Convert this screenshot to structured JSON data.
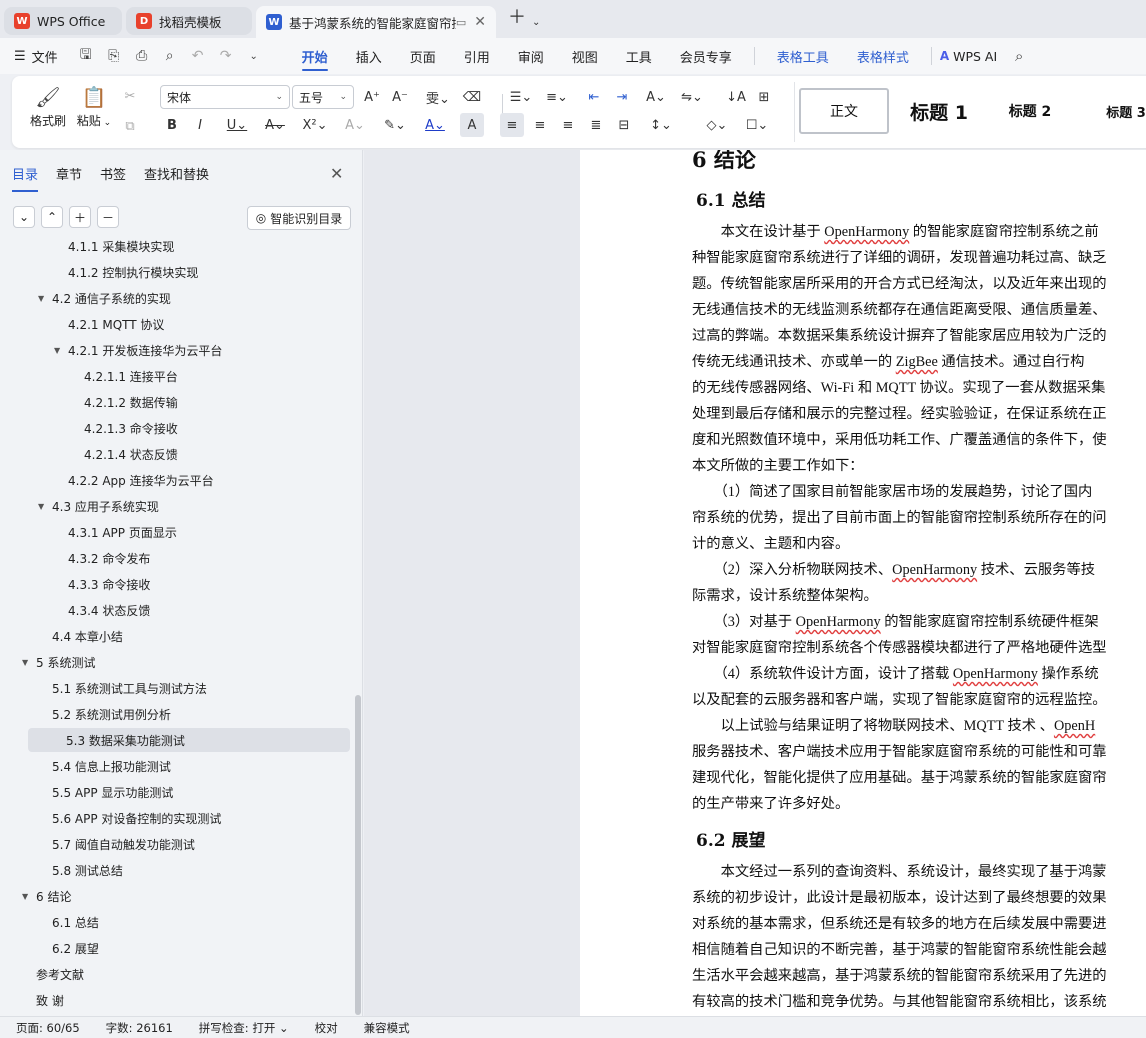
{
  "tabs": [
    {
      "label": "WPS Office",
      "logo": "W",
      "color": "#e8412c"
    },
    {
      "label": "找稻壳模板",
      "logo": "D",
      "color": "#e8412c"
    },
    {
      "label": "基于鸿蒙系统的智能家庭窗帘控",
      "logo": "W",
      "color": "#2f5fd0"
    }
  ],
  "menu": {
    "file": "文件",
    "items": [
      "开始",
      "插入",
      "页面",
      "引用",
      "审阅",
      "视图",
      "工具",
      "会员专享"
    ],
    "context": [
      "表格工具",
      "表格样式"
    ],
    "ai": "WPS AI"
  },
  "ribbon": {
    "format_painter": "格式刷",
    "paste": "粘贴",
    "font": "宋体",
    "size": "五号",
    "styles": [
      "正文",
      "标题 1",
      "标题 2",
      "标题 3"
    ]
  },
  "panel": {
    "tabs": [
      "目录",
      "章节",
      "书签",
      "查找和替换"
    ],
    "smart_toc": "智能识别目录",
    "toc": [
      {
        "label": "4.1.1 采集模块实现",
        "level": 2,
        "tri": ""
      },
      {
        "label": "4.1.2 控制执行模块实现",
        "level": 2,
        "tri": ""
      },
      {
        "label": "4.2 通信子系统的实现",
        "level": 1,
        "tri": "▼"
      },
      {
        "label": "4.2.1 MQTT 协议",
        "level": 2,
        "tri": ""
      },
      {
        "label": "4.2.1 开发板连接华为云平台",
        "level": 2,
        "tri": "▼"
      },
      {
        "label": "4.2.1.1 连接平台",
        "level": 3,
        "tri": ""
      },
      {
        "label": "4.2.1.2 数据传输",
        "level": 3,
        "tri": ""
      },
      {
        "label": "4.2.1.3 命令接收",
        "level": 3,
        "tri": ""
      },
      {
        "label": "4.2.1.4 状态反馈",
        "level": 3,
        "tri": ""
      },
      {
        "label": "4.2.2 App 连接华为云平台",
        "level": 2,
        "tri": ""
      },
      {
        "label": "4.3 应用子系统实现",
        "level": 1,
        "tri": "▼"
      },
      {
        "label": "4.3.1 APP 页面显示",
        "level": 2,
        "tri": ""
      },
      {
        "label": "4.3.2 命令发布",
        "level": 2,
        "tri": ""
      },
      {
        "label": "4.3.3 命令接收",
        "level": 2,
        "tri": ""
      },
      {
        "label": "4.3.4 状态反馈",
        "level": 2,
        "tri": ""
      },
      {
        "label": "4.4 本章小结",
        "level": 1,
        "tri": ""
      },
      {
        "label": "5 系统测试",
        "level": 0,
        "tri": "▼"
      },
      {
        "label": "5.1 系统测试工具与测试方法",
        "level": 1,
        "tri": ""
      },
      {
        "label": "5.2 系统测试用例分析",
        "level": 1,
        "tri": ""
      },
      {
        "label": "5.3 数据采集功能测试",
        "level": 1,
        "tri": "",
        "selected": true
      },
      {
        "label": "5.4 信息上报功能测试",
        "level": 1,
        "tri": ""
      },
      {
        "label": "5.5 APP 显示功能测试",
        "level": 1,
        "tri": ""
      },
      {
        "label": "5.6 APP 对设备控制的实现测试",
        "level": 1,
        "tri": ""
      },
      {
        "label": "5.7 阈值自动触发功能测试",
        "level": 1,
        "tri": ""
      },
      {
        "label": "5.8 测试总结",
        "level": 1,
        "tri": ""
      },
      {
        "label": "6 结论",
        "level": 0,
        "tri": "▼"
      },
      {
        "label": "6.1 总结",
        "level": 1,
        "tri": ""
      },
      {
        "label": "6.2 展望",
        "level": 1,
        "tri": ""
      },
      {
        "label": "参考文献",
        "level": 0,
        "tri": ""
      },
      {
        "label": "致  谢",
        "level": 0,
        "tri": ""
      }
    ]
  },
  "doc": {
    "h1": "6 结论",
    "h2a": "6.1 总结",
    "h2b": "6.2 展望",
    "lines": [
      [
        {
          "t": "　　本文在设计基于 "
        },
        {
          "t": "OpenHarmony",
          "s": 1
        },
        {
          "t": " 的智能家庭窗帘控制系统之前"
        }
      ],
      [
        {
          "t": "种智能家庭窗帘系统进行了详细的调研，发现普遍功耗过高、缺乏"
        }
      ],
      [
        {
          "t": "题。传统智能家居所采用的开合方式已经淘汰，以及近年来出现的"
        }
      ],
      [
        {
          "t": "无线通信技术的无线监测系统都存在通信距离受限、通信质量差、"
        }
      ],
      [
        {
          "t": "过高的弊端。本数据采集系统设计摒弃了智能家居应用较为广泛的"
        }
      ],
      [
        {
          "t": "传统无线通讯技术、亦或单一的 "
        },
        {
          "t": "ZigBee",
          "s": 1
        },
        {
          "t": " 通信技术。通过自行构"
        }
      ],
      [
        {
          "t": "的无线传感器网络、Wi-Fi 和 MQTT 协议。实现了一套从数据采集"
        }
      ],
      [
        {
          "t": "处理到最后存储和展示的完整过程。经实验验证，在保证系统在正"
        }
      ],
      [
        {
          "t": "度和光照数值环境中，采用低功耗工作、广覆盖通信的条件下，使"
        }
      ],
      [
        {
          "t": "本文所做的主要工作如下："
        }
      ],
      [
        {
          "t": "　　（1）简述了国家目前智能家居市场的发展趋势，讨论了国内"
        }
      ],
      [
        {
          "t": "帘系统的优势，提出了目前市面上的智能窗帘控制系统所存在的问"
        }
      ],
      [
        {
          "t": "计的意义、主题和内容。"
        }
      ],
      [
        {
          "t": "　　（2）深入分析物联网技术、"
        },
        {
          "t": "OpenHarmony",
          "s": 1
        },
        {
          "t": " 技术、云服务等技"
        }
      ],
      [
        {
          "t": "际需求，设计系统整体架构。"
        }
      ],
      [
        {
          "t": "　　（3）对基于 "
        },
        {
          "t": "OpenHarmony",
          "s": 1
        },
        {
          "t": " 的智能家庭窗帘控制系统硬件框架"
        }
      ],
      [
        {
          "t": "对智能家庭窗帘控制系统各个传感器模块都进行了严格地硬件选型"
        }
      ],
      [
        {
          "t": "　　（4）系统软件设计方面，设计了搭载 "
        },
        {
          "t": "OpenHarmony",
          "s": 1
        },
        {
          "t": " 操作系统"
        }
      ],
      [
        {
          "t": "以及配套的云服务器和客户端，实现了智能家庭窗帘的远程监控。"
        }
      ],
      [
        {
          "t": "　　以上试验与结果证明了将物联网技术、MQTT 技术 、"
        },
        {
          "t": "OpenH",
          "s": 1
        }
      ],
      [
        {
          "t": "服务器技术、客户端技术应用于智能家庭窗帘系统的可能性和可靠"
        }
      ],
      [
        {
          "t": "建现代化，智能化提供了应用基础。基于鸿蒙系统的智能家庭窗帘"
        }
      ],
      [
        {
          "t": "的生产带来了许多好处。"
        }
      ]
    ],
    "lines2": [
      [
        {
          "t": "　　本文经过一系列的查询资料、系统设计，最终实现了基于鸿蒙"
        }
      ],
      [
        {
          "t": "系统的初步设计，此设计是最初版本，设计达到了最终想要的效果"
        }
      ],
      [
        {
          "t": "对系统的基本需求，但系统还是有较多的地方在后续发展中需要进"
        }
      ],
      [
        {
          "t": "相信随着自己知识的不断完善，基于鸿蒙的智能窗帘系统性能会越"
        }
      ],
      [
        {
          "t": "生活水平会越来越高，基于鸿蒙系统的智能窗帘系统采用了先进的"
        }
      ],
      [
        {
          "t": "有较高的技术门槛和竞争优势。与其他智能窗帘系统相比，该系统"
        }
      ]
    ]
  },
  "status": {
    "page": "页面: 60/65",
    "words": "字数: 26161",
    "spell": "拼写检查: 打开",
    "proof": "校对",
    "compat": "兼容模式"
  }
}
